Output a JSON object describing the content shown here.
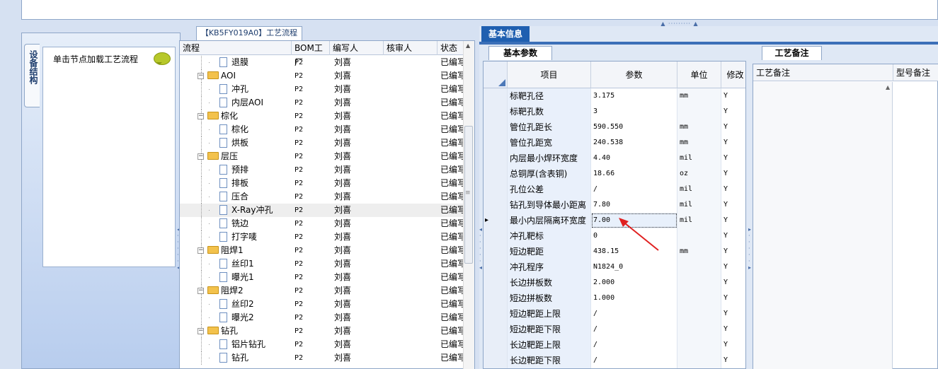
{
  "flow_tab": {
    "title": "【KB5FY019A0】工艺流程"
  },
  "device_tab": {
    "label": "设备结构"
  },
  "hint": {
    "text": "单击节点加载工艺流程"
  },
  "flow_grid": {
    "columns": [
      "流程",
      "BOM工厂",
      "编写人",
      "核审人",
      "状态"
    ],
    "rows": [
      {
        "name": "退膜",
        "bom": "P2",
        "writer": "刘喜",
        "reviewer": "",
        "status": "已编写"
      },
      {
        "name": "AOI",
        "bom": "P2",
        "writer": "刘喜",
        "reviewer": "",
        "status": "已编写",
        "folder": true
      },
      {
        "name": "冲孔",
        "bom": "P2",
        "writer": "刘喜",
        "reviewer": "",
        "status": "已编写"
      },
      {
        "name": "内层AOI",
        "bom": "P2",
        "writer": "刘喜",
        "reviewer": "",
        "status": "已编写"
      },
      {
        "name": "棕化",
        "bom": "P2",
        "writer": "刘喜",
        "reviewer": "",
        "status": "已编写",
        "folder": true
      },
      {
        "name": "棕化",
        "bom": "P2",
        "writer": "刘喜",
        "reviewer": "",
        "status": "已编写"
      },
      {
        "name": "烘板",
        "bom": "P2",
        "writer": "刘喜",
        "reviewer": "",
        "status": "已编写"
      },
      {
        "name": "层压",
        "bom": "P2",
        "writer": "刘喜",
        "reviewer": "",
        "status": "已编写",
        "folder": true
      },
      {
        "name": "预排",
        "bom": "P2",
        "writer": "刘喜",
        "reviewer": "",
        "status": "已编写"
      },
      {
        "name": "排板",
        "bom": "P2",
        "writer": "刘喜",
        "reviewer": "",
        "status": "已编写"
      },
      {
        "name": "压合",
        "bom": "P2",
        "writer": "刘喜",
        "reviewer": "",
        "status": "已编写"
      },
      {
        "name": "X-Ray冲孔",
        "bom": "P2",
        "writer": "刘喜",
        "reviewer": "",
        "status": "已编写"
      },
      {
        "name": "铣边",
        "bom": "P2",
        "writer": "刘喜",
        "reviewer": "",
        "status": "已编写"
      },
      {
        "name": "打字唛",
        "bom": "P2",
        "writer": "刘喜",
        "reviewer": "",
        "status": "已编写"
      },
      {
        "name": "阻焊1",
        "bom": "P2",
        "writer": "刘喜",
        "reviewer": "",
        "status": "已编写",
        "folder": true
      },
      {
        "name": "丝印1",
        "bom": "P2",
        "writer": "刘喜",
        "reviewer": "",
        "status": "已编写"
      },
      {
        "name": "曝光1",
        "bom": "P2",
        "writer": "刘喜",
        "reviewer": "",
        "status": "已编写"
      },
      {
        "name": "阻焊2",
        "bom": "P2",
        "writer": "刘喜",
        "reviewer": "",
        "status": "已编写",
        "folder": true
      },
      {
        "name": "丝印2",
        "bom": "P2",
        "writer": "刘喜",
        "reviewer": "",
        "status": "已编写"
      },
      {
        "name": "曝光2",
        "bom": "P2",
        "writer": "刘喜",
        "reviewer": "",
        "status": "已编写"
      },
      {
        "name": "钻孔",
        "bom": "P2",
        "writer": "刘喜",
        "reviewer": "",
        "status": "已编写",
        "folder": true
      },
      {
        "name": "铝片钻孔",
        "bom": "P2",
        "writer": "刘喜",
        "reviewer": "",
        "status": "已编写"
      },
      {
        "name": "钻孔",
        "bom": "P2",
        "writer": "刘喜",
        "reviewer": "",
        "status": "已编写"
      }
    ]
  },
  "basic_info": {
    "tab_label": "基本信息",
    "sub_tab_label": "基本参数"
  },
  "param_grid": {
    "columns": [
      "项目",
      "参数",
      "单位",
      "修改"
    ],
    "rows": [
      {
        "item": "标靶孔径",
        "value": "3.175",
        "unit": "mm",
        "mod": "Y"
      },
      {
        "item": "标靶孔数",
        "value": "3",
        "unit": "",
        "mod": "Y"
      },
      {
        "item": "管位孔距长",
        "value": "590.550",
        "unit": "mm",
        "mod": "Y"
      },
      {
        "item": "管位孔距宽",
        "value": "240.538",
        "unit": "mm",
        "mod": "Y"
      },
      {
        "item": "内层最小焊环宽度",
        "value": "4.40",
        "unit": "mil",
        "mod": "Y"
      },
      {
        "item": "总铜厚(含表铜)",
        "value": "18.66",
        "unit": "oz",
        "mod": "Y"
      },
      {
        "item": "孔位公差",
        "value": "/",
        "unit": "mil",
        "mod": "Y"
      },
      {
        "item": "钻孔到导体最小距离",
        "value": "7.80",
        "unit": "mil",
        "mod": "Y"
      },
      {
        "item": "最小内层隔离环宽度",
        "value": "7.00",
        "unit": "mil",
        "mod": "Y",
        "current": true
      },
      {
        "item": "冲孔靶标",
        "value": "0",
        "unit": "",
        "mod": "Y"
      },
      {
        "item": "短边靶距",
        "value": "438.15",
        "unit": "mm",
        "mod": "Y"
      },
      {
        "item": "冲孔程序",
        "value": "N1824_0",
        "unit": "",
        "mod": "Y"
      },
      {
        "item": "长边拼板数",
        "value": "2.000",
        "unit": "",
        "mod": "Y"
      },
      {
        "item": "短边拼板数",
        "value": "1.000",
        "unit": "",
        "mod": "Y"
      },
      {
        "item": "短边靶距上限",
        "value": "/",
        "unit": "",
        "mod": "Y"
      },
      {
        "item": "短边靶距下限",
        "value": "/",
        "unit": "",
        "mod": "Y"
      },
      {
        "item": "长边靶距上限",
        "value": "/",
        "unit": "",
        "mod": "Y"
      },
      {
        "item": "长边靶距下限",
        "value": "/",
        "unit": "",
        "mod": "Y"
      }
    ]
  },
  "remark": {
    "tab_label": "工艺备注",
    "columns": [
      "工艺备注",
      "型号备注"
    ]
  },
  "colors": {
    "accent": "#1f5fb0",
    "folder": "#f3c24c",
    "arrow": "#e02020"
  }
}
